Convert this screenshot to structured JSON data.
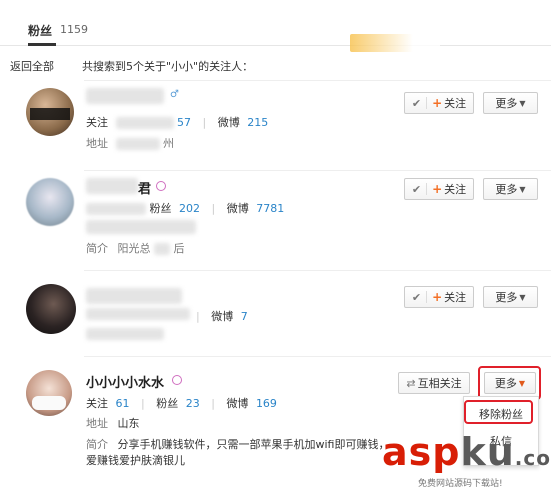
{
  "tab": {
    "label": "粉丝",
    "count": "1159"
  },
  "back_link": "返回全部",
  "search_summary": "共搜索到5个关于\"小小\"的关注人：",
  "buttons": {
    "follow": "关注",
    "mutual": "互相关注",
    "more": "更多"
  },
  "users": [
    {
      "stats": {
        "following_label": "关注",
        "following_value": "",
        "fans_value": "57",
        "weibo_label": "微博",
        "weibo_value": "215"
      },
      "location_label": "地址",
      "location_value": "州"
    },
    {
      "name_suffix": "君",
      "stats": {
        "fans_label": "粉丝",
        "fans_value": "202",
        "weibo_label": "微博",
        "weibo_value": "7781"
      },
      "bio_label": "简介",
      "bio_value": "阳光总",
      "bio_tail": "后"
    },
    {
      "stats": {
        "weibo_label": "微博",
        "weibo_value": "7"
      }
    },
    {
      "name": "小小小小水水",
      "stats": {
        "following_label": "关注",
        "following_value": "61",
        "fans_label": "粉丝",
        "fans_value": "23",
        "weibo_label": "微博",
        "weibo_value": "169"
      },
      "location_label": "地址",
      "location_value": "山东",
      "bio_label": "简介",
      "bio_value": "分享手机赚钱软件，只需一部苹果手机加wifi即可赚钱，",
      "bio_line2": "爱赚钱爱护肤滴银儿"
    }
  ],
  "dropdown": {
    "remove_fan": "移除粉丝",
    "message": "私信"
  },
  "watermark": {
    "part1": "asp",
    "part2": "ku",
    "part3": ".com",
    "subtitle": "免费网站源码下载站!"
  },
  "colors": {
    "accent_link": "#2a84c8",
    "follow_plus": "#f36f25",
    "highlight": "#e0202a",
    "watermark": "#d81e06"
  }
}
